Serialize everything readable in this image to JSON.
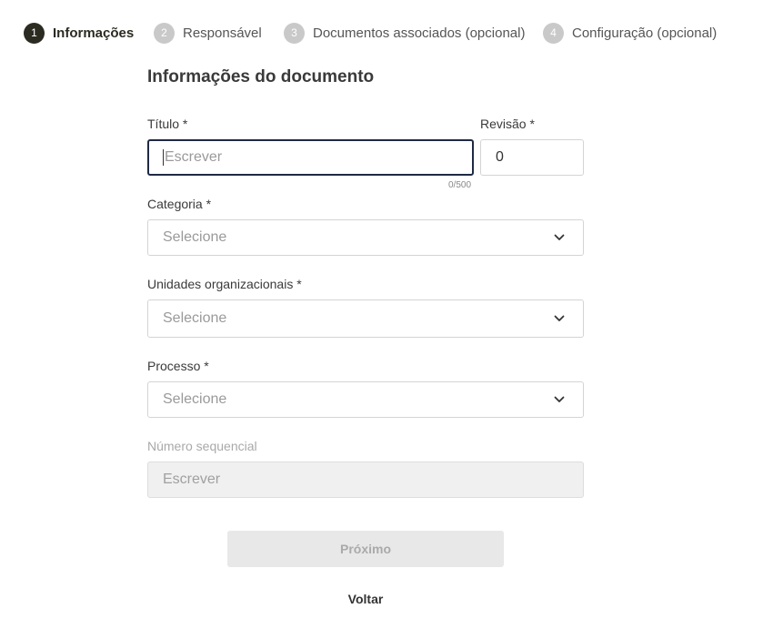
{
  "stepper": {
    "steps": [
      {
        "number": "1",
        "label": "Informações",
        "active": true
      },
      {
        "number": "2",
        "label": "Responsável",
        "active": false
      },
      {
        "number": "3",
        "label": "Documentos associados (opcional)",
        "active": false
      },
      {
        "number": "4",
        "label": "Configuração (opcional)",
        "active": false
      }
    ]
  },
  "form": {
    "title": "Informações do documento",
    "titulo": {
      "label": "Título *",
      "placeholder": "Escrever",
      "counter": "0/500"
    },
    "revisao": {
      "label": "Revisão *",
      "value": "0"
    },
    "categoria": {
      "label": "Categoria *",
      "placeholder": "Selecione"
    },
    "unidades": {
      "label": "Unidades organizacionais *",
      "placeholder": "Selecione"
    },
    "processo": {
      "label": "Processo *",
      "placeholder": "Selecione"
    },
    "numero": {
      "label": "Número sequencial",
      "placeholder": "Escrever"
    },
    "next_label": "Próximo",
    "back_label": "Voltar"
  },
  "icons": {
    "dropdown": "chevron-down-icon"
  },
  "colors": {
    "active_step": "#2b2b21",
    "inactive_step": "#c9c9c9",
    "focus_border": "#1f2a44",
    "disabled_bg": "#f0f0f0"
  }
}
